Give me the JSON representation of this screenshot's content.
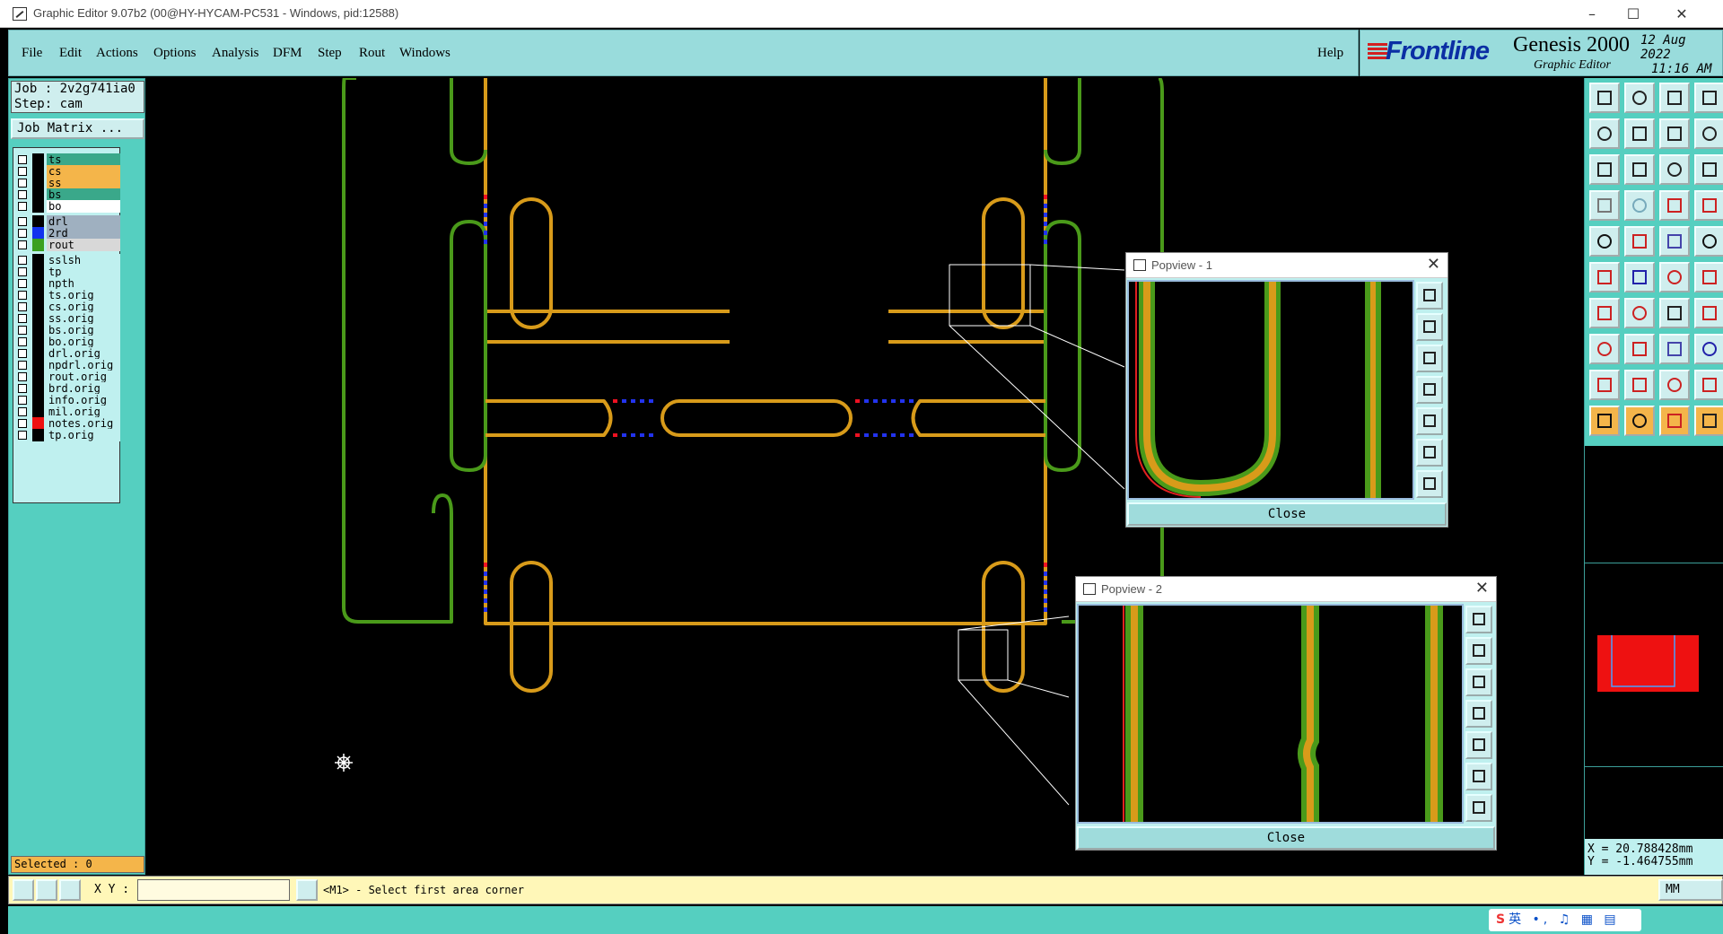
{
  "window": {
    "title": "Graphic Editor 9.07b2 (00@HY-HYCAM-PC531 - Windows, pid:12588)",
    "controls": [
      "minimize",
      "maximize",
      "close"
    ]
  },
  "menu": {
    "items": [
      "File",
      "Edit",
      "Actions",
      "Options",
      "Analysis",
      "DFM",
      "Step",
      "Rout",
      "Windows"
    ],
    "help": "Help"
  },
  "branding": {
    "logo": "Frontline",
    "product": "Genesis 2000",
    "subtitle": "Graphic Editor",
    "date": "12 Aug 2022",
    "time": "11:16 AM"
  },
  "job": {
    "job_line": "Job : 2v2g741ia0",
    "step_line": "Step: cam",
    "matrix_button": "Job Matrix ..."
  },
  "layers": [
    {
      "name": "ts",
      "color": "#3aa88a"
    },
    {
      "name": "cs",
      "color": "#f4b54a"
    },
    {
      "name": "ss",
      "color": "#f4b54a"
    },
    {
      "name": "bs",
      "color": "#3aa88a"
    },
    {
      "name": "bo",
      "color": "#ffffff"
    },
    {
      "name": "drl",
      "color": "#9fb0c0"
    },
    {
      "name": "2rd",
      "color": "#9fb0c0",
      "swatch": "#1133ee"
    },
    {
      "name": "rout",
      "color": "#d8d8d8",
      "swatch": "#3aa020"
    },
    {
      "name": "sslsh",
      "color": "#bff0ef"
    },
    {
      "name": "tp",
      "color": "#bff0ef"
    },
    {
      "name": "npth",
      "color": "#bff0ef"
    },
    {
      "name": "ts.orig",
      "color": "#bff0ef"
    },
    {
      "name": "cs.orig",
      "color": "#bff0ef"
    },
    {
      "name": "ss.orig",
      "color": "#bff0ef"
    },
    {
      "name": "bs.orig",
      "color": "#bff0ef"
    },
    {
      "name": "bo.orig",
      "color": "#bff0ef"
    },
    {
      "name": "drl.orig",
      "color": "#bff0ef"
    },
    {
      "name": "npdrl.orig",
      "color": "#bff0ef"
    },
    {
      "name": "rout.orig",
      "color": "#bff0ef"
    },
    {
      "name": "brd.orig",
      "color": "#bff0ef"
    },
    {
      "name": "info.orig",
      "color": "#bff0ef"
    },
    {
      "name": "mil.orig",
      "color": "#bff0ef"
    },
    {
      "name": "notes.orig",
      "color": "#bff0ef",
      "swatch": "#ee1111"
    },
    {
      "name": "tp.orig",
      "color": "#bff0ef"
    }
  ],
  "selection": {
    "label": "Selected : 0"
  },
  "popview1": {
    "title": "Popview - 1",
    "close": "Close"
  },
  "popview2": {
    "title": "Popview - 2",
    "close": "Close"
  },
  "coordinates": {
    "x": "X = 20.788428mm",
    "y": "Y = -1.464755mm"
  },
  "command": {
    "xy_label": "X Y :",
    "xy_value": "",
    "prompt": "<M1> - Select first area corner",
    "unit": "MM"
  },
  "tray": {
    "ime": "英"
  },
  "colors": {
    "route_green": "#4a9a1a",
    "route_orange": "#d89b1a",
    "route_red": "#e02020",
    "panel_teal": "#55cfc0",
    "menu_bg": "#99dcdc"
  }
}
